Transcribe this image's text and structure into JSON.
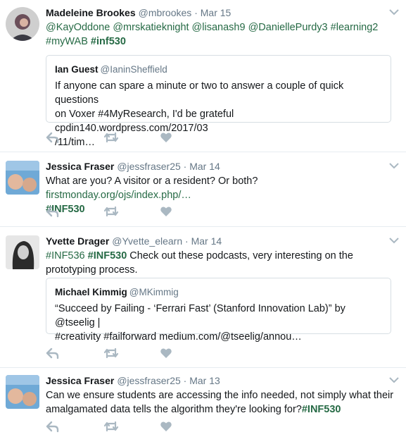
{
  "colors": {
    "accent": "#266a45",
    "muted": "#657786",
    "icon": "#aab8c2",
    "border": "#e6ecf0"
  },
  "tweets": [
    {
      "name": "Madeleine Brookes",
      "handle": "@mbrookes",
      "time": "Mar 15",
      "dot": "·",
      "text_line1": "@KayOddone @mrskatieknight @lisanash9 @DaniellePurdy3 #learning2",
      "text_line2_a": "#myWAB ",
      "text_line2_b": "#inf530",
      "quote": {
        "name": "Ian Guest",
        "handle": "@IaninSheffield",
        "line1": "If anyone can spare a minute or two to answer a couple of quick questions",
        "line2": "on Voxer #4MyResearch, I'd be grateful cpdin140.wordpress.com/2017/03",
        "line3": "/11/tim…"
      }
    },
    {
      "name": "Jessica Fraser",
      "handle": "@jessfraser25",
      "time": "Mar 14",
      "dot": "·",
      "text_a": "What are you? A visitor or a resident? Or both? ",
      "text_link": "firstmonday.org/ojs/index.php/…",
      "text_tag": "#INF530"
    },
    {
      "name": "Yvette Drager",
      "handle": "@Yvette_elearn",
      "time": "Mar 14",
      "dot": "·",
      "tag1": "#INF536",
      "tag2": "#INF530",
      "text_rest": " Check out these podcasts, very interesting on the prototyping process.",
      "quote": {
        "name": "Michael Kimmig",
        "handle": "@MKimmig",
        "line1": "“Succeed by Failing - ‘Ferrari Fast’ (Stanford Innovation Lab)” by @tseelig |",
        "line2": "#creativity #failforward medium.com/@tseelig/annou…"
      }
    },
    {
      "name": "Jessica Fraser",
      "handle": "@jessfraser25",
      "time": "Mar 13",
      "dot": "·",
      "text_a": "Can we ensure students are accessing the info needed, not simply what their amalgamated data tells the algorithm they're looking for?",
      "text_tag": "#INF530"
    }
  ]
}
